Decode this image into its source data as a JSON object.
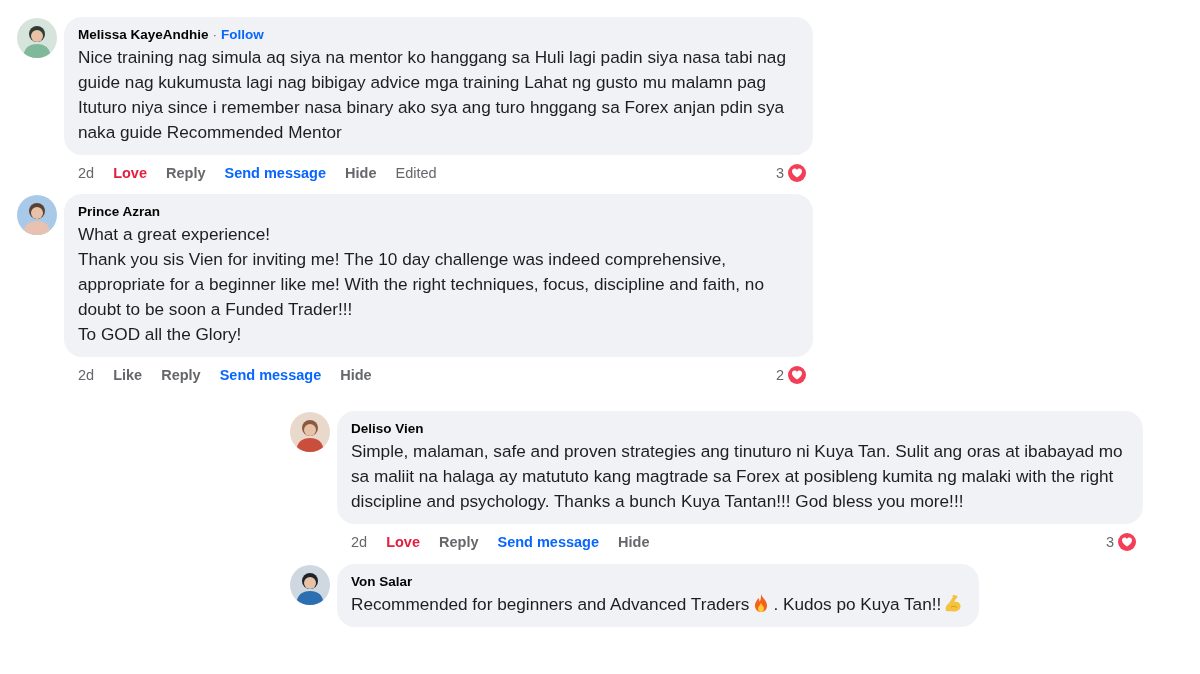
{
  "comments": [
    {
      "author": "Melissa KayeAndhie",
      "separator": "·",
      "follow": "Follow",
      "body": [
        {
          "kind": "text",
          "text": "Nice training nag simula aq siya na mentor ko hanggang sa Huli lagi padin siya nasa tabi nag guide nag kukumusta lagi nag bibigay advice mga training Lahat ng gusto mu malamn pag Ituturo niya since i remember nasa binary ako sya ang turo hnggang sa Forex anjan pdin sya naka guide Recommended Mentor"
        }
      ],
      "actions": [
        {
          "kind": "time",
          "text": "2d"
        },
        {
          "kind": "react",
          "text": "Love",
          "selected": true
        },
        {
          "kind": "reply",
          "text": "Reply"
        },
        {
          "kind": "message",
          "text": "Send message"
        },
        {
          "kind": "hide",
          "text": "Hide"
        },
        {
          "kind": "edited",
          "text": "Edited"
        }
      ],
      "reaction_count": "3"
    },
    {
      "author": "Prince Azran",
      "body": [
        {
          "kind": "text",
          "text": "What a great experience!\nThank you sis Vien for inviting me! The 10 day challenge was indeed comprehensive, appropriate for a beginner like me! With the right techniques, focus, discipline and faith, no doubt to be soon a Funded Trader!!!\nTo GOD all the Glory!"
        }
      ],
      "actions": [
        {
          "kind": "time",
          "text": "2d"
        },
        {
          "kind": "react",
          "text": "Like",
          "selected": false
        },
        {
          "kind": "reply",
          "text": "Reply"
        },
        {
          "kind": "message",
          "text": "Send message"
        },
        {
          "kind": "hide",
          "text": "Hide"
        }
      ],
      "reaction_count": "2",
      "replies": [
        {
          "author": "Deliso Vien",
          "body": [
            {
              "kind": "text",
              "text": "Simple, malaman, safe and proven strategies ang tinuturo ni Kuya Tan. Sulit ang oras at ibabayad mo sa maliit na halaga ay matututo kang magtrade sa Forex at posibleng kumita ng malaki with the right discipline and psychology. Thanks a bunch Kuya Tantan!!! God bless you more!!!"
            }
          ],
          "actions": [
            {
              "kind": "time",
              "text": "2d"
            },
            {
              "kind": "react",
              "text": "Love",
              "selected": true
            },
            {
              "kind": "reply",
              "text": "Reply"
            },
            {
              "kind": "message",
              "text": "Send message"
            },
            {
              "kind": "hide",
              "text": "Hide"
            }
          ],
          "reaction_count": "3"
        },
        {
          "author": "Von Salar",
          "body": [
            {
              "kind": "text",
              "text": "Recommended for beginners and Advanced Traders"
            },
            {
              "kind": "fire"
            },
            {
              "kind": "text",
              "text": ". Kudos po Kuya Tan!!"
            },
            {
              "kind": "muscle"
            }
          ]
        }
      ]
    }
  ]
}
